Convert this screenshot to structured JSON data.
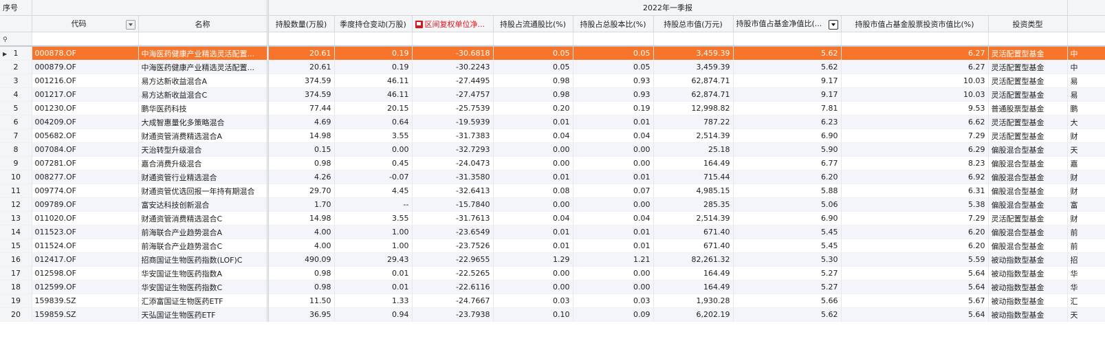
{
  "header": {
    "index_label": "序号",
    "group_label": "2022年一季报",
    "filter_icon": "pin-icon",
    "columns": [
      {
        "key": "code",
        "label": "代码"
      },
      {
        "key": "name",
        "label": "名称"
      },
      {
        "key": "shares",
        "label": "持股数量(万股)"
      },
      {
        "key": "change",
        "label": "季度持仓变动(万股)"
      },
      {
        "key": "ret",
        "label": "区间复权单位净..."
      },
      {
        "key": "float_pct",
        "label": "持股占流通股比(%)"
      },
      {
        "key": "total_pct",
        "label": "持股占总股本比(%)"
      },
      {
        "key": "mktval",
        "label": "持股总市值(万元)"
      },
      {
        "key": "nav_pct",
        "label": "持股市值占基金净值比(..."
      },
      {
        "key": "stock_pct",
        "label": "持股市值占基金股票投资市值比(%)"
      },
      {
        "key": "type",
        "label": "投资类型"
      }
    ]
  },
  "accent_color": "#f7752a",
  "rows": [
    {
      "idx": "1",
      "code": "000878.OF",
      "name": "中海医药健康产业精选灵活配置...",
      "shares": "20.61",
      "change": "0.19",
      "ret": "-30.6818",
      "float_pct": "0.05",
      "total_pct": "0.05",
      "mktval": "3,459.39",
      "nav_pct": "5.62",
      "stock_pct": "6.27",
      "type": "灵活配置型基金",
      "extra": "中"
    },
    {
      "idx": "2",
      "code": "000879.OF",
      "name": "中海医药健康产业精选灵活配置...",
      "shares": "20.61",
      "change": "0.19",
      "ret": "-30.2243",
      "float_pct": "0.05",
      "total_pct": "0.05",
      "mktval": "3,459.39",
      "nav_pct": "5.62",
      "stock_pct": "6.27",
      "type": "灵活配置型基金",
      "extra": "中"
    },
    {
      "idx": "3",
      "code": "001216.OF",
      "name": "易方达新收益混合A",
      "shares": "374.59",
      "change": "46.11",
      "ret": "-27.4495",
      "float_pct": "0.98",
      "total_pct": "0.93",
      "mktval": "62,874.71",
      "nav_pct": "9.17",
      "stock_pct": "10.03",
      "type": "灵活配置型基金",
      "extra": "易"
    },
    {
      "idx": "4",
      "code": "001217.OF",
      "name": "易方达新收益混合C",
      "shares": "374.59",
      "change": "46.11",
      "ret": "-27.4757",
      "float_pct": "0.98",
      "total_pct": "0.93",
      "mktval": "62,874.71",
      "nav_pct": "9.17",
      "stock_pct": "10.03",
      "type": "灵活配置型基金",
      "extra": "易"
    },
    {
      "idx": "5",
      "code": "001230.OF",
      "name": "鹏华医药科技",
      "shares": "77.44",
      "change": "20.15",
      "ret": "-25.7539",
      "float_pct": "0.20",
      "total_pct": "0.19",
      "mktval": "12,998.82",
      "nav_pct": "7.81",
      "stock_pct": "9.53",
      "type": "普通股票型基金",
      "extra": "鹏"
    },
    {
      "idx": "6",
      "code": "004209.OF",
      "name": "大成智惠量化多策略混合",
      "shares": "4.69",
      "change": "0.64",
      "ret": "-19.5939",
      "float_pct": "0.01",
      "total_pct": "0.01",
      "mktval": "787.22",
      "nav_pct": "6.23",
      "stock_pct": "6.62",
      "type": "灵活配置型基金",
      "extra": "大"
    },
    {
      "idx": "7",
      "code": "005682.OF",
      "name": "财通资管消费精选混合A",
      "shares": "14.98",
      "change": "3.55",
      "ret": "-31.7383",
      "float_pct": "0.04",
      "total_pct": "0.04",
      "mktval": "2,514.39",
      "nav_pct": "6.90",
      "stock_pct": "7.29",
      "type": "灵活配置型基金",
      "extra": "财"
    },
    {
      "idx": "8",
      "code": "007084.OF",
      "name": "天治转型升级混合",
      "shares": "0.15",
      "change": "0.00",
      "ret": "-32.7293",
      "float_pct": "0.00",
      "total_pct": "0.00",
      "mktval": "25.18",
      "nav_pct": "5.90",
      "stock_pct": "6.29",
      "type": "偏股混合型基金",
      "extra": "天"
    },
    {
      "idx": "9",
      "code": "007281.OF",
      "name": "嘉合消费升级混合",
      "shares": "0.98",
      "change": "0.45",
      "ret": "-24.0473",
      "float_pct": "0.00",
      "total_pct": "0.00",
      "mktval": "164.49",
      "nav_pct": "6.77",
      "stock_pct": "8.23",
      "type": "偏股混合型基金",
      "extra": "嘉"
    },
    {
      "idx": "10",
      "code": "008277.OF",
      "name": "财通资管行业精选混合",
      "shares": "4.26",
      "change": "-0.07",
      "ret": "-31.3580",
      "float_pct": "0.01",
      "total_pct": "0.01",
      "mktval": "715.44",
      "nav_pct": "6.20",
      "stock_pct": "6.92",
      "type": "偏股混合型基金",
      "extra": "财"
    },
    {
      "idx": "11",
      "code": "009774.OF",
      "name": "财通资管优选回报一年持有期混合",
      "shares": "29.70",
      "change": "4.45",
      "ret": "-32.6413",
      "float_pct": "0.08",
      "total_pct": "0.07",
      "mktval": "4,985.15",
      "nav_pct": "5.88",
      "stock_pct": "6.31",
      "type": "偏股混合型基金",
      "extra": "财"
    },
    {
      "idx": "12",
      "code": "009789.OF",
      "name": "富安达科技创新混合",
      "shares": "1.70",
      "change": "--",
      "ret": "-15.7840",
      "float_pct": "0.00",
      "total_pct": "0.00",
      "mktval": "285.35",
      "nav_pct": "5.06",
      "stock_pct": "5.38",
      "type": "偏股混合型基金",
      "extra": "富"
    },
    {
      "idx": "13",
      "code": "011020.OF",
      "name": "财通资管消费精选混合C",
      "shares": "14.98",
      "change": "3.55",
      "ret": "-31.7613",
      "float_pct": "0.04",
      "total_pct": "0.04",
      "mktval": "2,514.39",
      "nav_pct": "6.90",
      "stock_pct": "7.29",
      "type": "灵活配置型基金",
      "extra": "财"
    },
    {
      "idx": "14",
      "code": "011523.OF",
      "name": "前海联合产业趋势混合A",
      "shares": "4.00",
      "change": "1.00",
      "ret": "-23.6549",
      "float_pct": "0.01",
      "total_pct": "0.01",
      "mktval": "671.40",
      "nav_pct": "5.45",
      "stock_pct": "6.20",
      "type": "偏股混合型基金",
      "extra": "前"
    },
    {
      "idx": "15",
      "code": "011524.OF",
      "name": "前海联合产业趋势混合C",
      "shares": "4.00",
      "change": "1.00",
      "ret": "-23.7526",
      "float_pct": "0.01",
      "total_pct": "0.01",
      "mktval": "671.40",
      "nav_pct": "5.45",
      "stock_pct": "6.20",
      "type": "偏股混合型基金",
      "extra": "前"
    },
    {
      "idx": "16",
      "code": "012417.OF",
      "name": "招商国证生物医药指数(LOF)C",
      "shares": "490.09",
      "change": "29.43",
      "ret": "-22.9655",
      "float_pct": "1.29",
      "total_pct": "1.21",
      "mktval": "82,261.32",
      "nav_pct": "5.30",
      "stock_pct": "5.59",
      "type": "被动指数型基金",
      "extra": "招"
    },
    {
      "idx": "17",
      "code": "012598.OF",
      "name": "华安国证生物医药指数A",
      "shares": "0.98",
      "change": "0.01",
      "ret": "-22.5265",
      "float_pct": "0.00",
      "total_pct": "0.00",
      "mktval": "164.49",
      "nav_pct": "5.27",
      "stock_pct": "5.64",
      "type": "被动指数型基金",
      "extra": "华"
    },
    {
      "idx": "18",
      "code": "012599.OF",
      "name": "华安国证生物医药指数C",
      "shares": "0.98",
      "change": "0.01",
      "ret": "-22.6116",
      "float_pct": "0.00",
      "total_pct": "0.00",
      "mktval": "164.49",
      "nav_pct": "5.27",
      "stock_pct": "5.64",
      "type": "被动指数型基金",
      "extra": "华"
    },
    {
      "idx": "19",
      "code": "159839.SZ",
      "name": "汇添富国证生物医药ETF",
      "shares": "11.50",
      "change": "1.33",
      "ret": "-24.7667",
      "float_pct": "0.03",
      "total_pct": "0.03",
      "mktval": "1,930.28",
      "nav_pct": "5.66",
      "stock_pct": "5.67",
      "type": "被动指数型基金",
      "extra": "汇"
    },
    {
      "idx": "20",
      "code": "159859.SZ",
      "name": "天弘国证生物医药ETF",
      "shares": "36.95",
      "change": "0.94",
      "ret": "-23.7938",
      "float_pct": "0.10",
      "total_pct": "0.09",
      "mktval": "6,202.19",
      "nav_pct": "5.62",
      "stock_pct": "5.64",
      "type": "被动指数型基金",
      "extra": "天"
    }
  ]
}
